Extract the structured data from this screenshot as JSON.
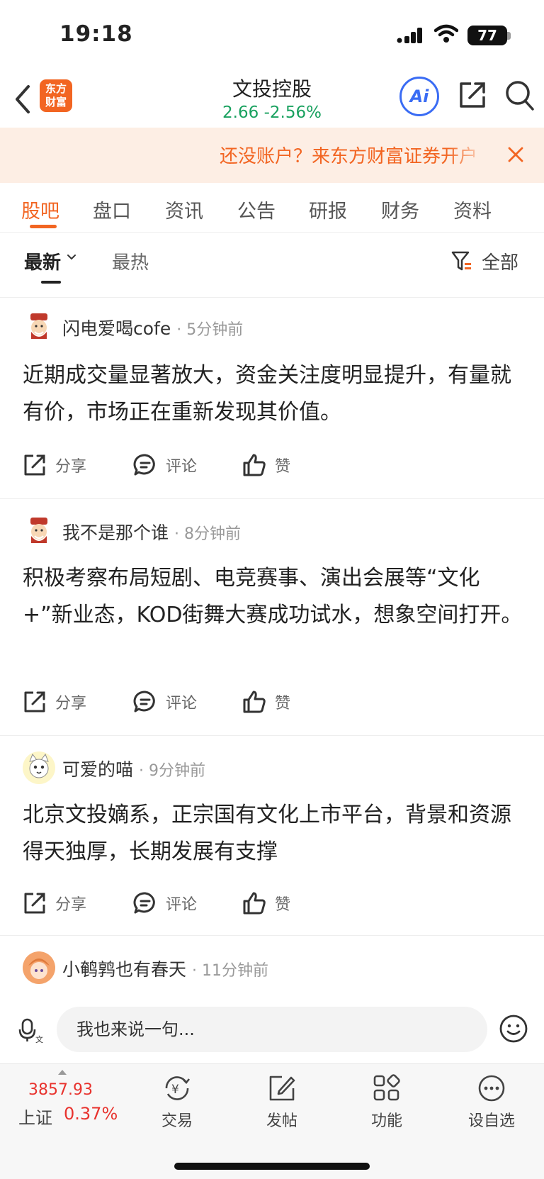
{
  "status": {
    "time": "19:18",
    "battery": "77"
  },
  "header": {
    "logo_text_line1": "东方",
    "logo_text_line2": "财富",
    "title": "文投控股",
    "quote": "2.66  -2.56%",
    "ai_label": "Ai"
  },
  "banner": {
    "text": "还没账户？来东方财富证券开户"
  },
  "tabs": [
    {
      "label": "股吧"
    },
    {
      "label": "盘口"
    },
    {
      "label": "资讯"
    },
    {
      "label": "公告"
    },
    {
      "label": "研报"
    },
    {
      "label": "财务"
    },
    {
      "label": "资料"
    }
  ],
  "sort": {
    "latest": "最新",
    "hot": "最热",
    "filter": "全部"
  },
  "posts": [
    {
      "author": "闪电爱喝cofe",
      "time": "· 5分钟前",
      "content": "近期成交量显著放大，资金关注度明显提升，有量就有价，市场正在重新发现其价值。"
    },
    {
      "author": "我不是那个谁",
      "time": "· 8分钟前",
      "content": "积极考察布局短剧、电竞赛事、演出会展等“文化+”新业态，KOD街舞大赛成功试水，想象空间打开。"
    },
    {
      "author": "可爱的喵",
      "time": "· 9分钟前",
      "content": "北京文投嫡系，正宗国有文化上市平台，背景和资源得天独厚，长期发展有支撑"
    },
    {
      "author": "小鹌鹑也有春天",
      "time": "· 11分钟前",
      "content": ""
    }
  ],
  "actions": {
    "share": "分享",
    "comment": "评论",
    "like": "赞"
  },
  "composer": {
    "placeholder": "我也来说一句..."
  },
  "bottom": {
    "index_value": "3857.93",
    "index_name": "上证",
    "index_change": "0.37%",
    "trade": "交易",
    "post": "发帖",
    "func": "功能",
    "watch": "设自选"
  }
}
